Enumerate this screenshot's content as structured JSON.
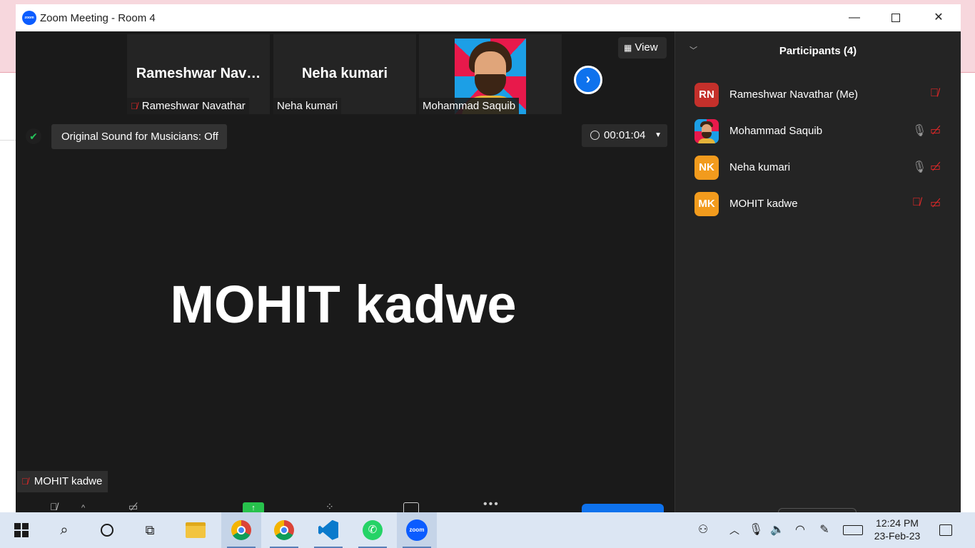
{
  "window": {
    "title": "Zoom Meeting - Room 4",
    "app_icon_text": "zoom",
    "controls": {
      "minimize": "—",
      "close": "✕"
    }
  },
  "thumbnails": [
    {
      "display": "Rameshwar  Nav…",
      "label": "Rameshwar Navathar",
      "muted": true
    },
    {
      "display": "Neha kumari",
      "label": "Neha kumari",
      "muted": false
    },
    {
      "display": "",
      "label": "Mohammad Saquib",
      "muted": false,
      "has_avatar": true
    }
  ],
  "controls_overlay": {
    "next_page": "›",
    "view_label": "View",
    "view_icon": "grid-icon",
    "original_sound": "Original Sound for Musicians: Off",
    "timer": "00:01:04"
  },
  "active_speaker": {
    "name": "MOHIT kadwe",
    "label": "MOHIT kadwe",
    "muted": true
  },
  "participants_panel": {
    "title": "Participants (4)",
    "participants": [
      {
        "initials": "RN",
        "name": "Rameshwar Navathar (Me)",
        "color": "#c4302b",
        "mic": "muted",
        "cam": "none"
      },
      {
        "initials": "",
        "name": "Mohammad Saquib",
        "color": "#e8194b",
        "mic": "on",
        "cam": "off",
        "has_avatar": true
      },
      {
        "initials": "NK",
        "name": "Neha kumari",
        "color": "#f29b1d",
        "mic": "on",
        "cam": "off"
      },
      {
        "initials": "MK",
        "name": "MOHIT kadwe",
        "color": "#f29b1d",
        "mic": "muted",
        "cam": "off"
      }
    ]
  },
  "taskbar": {
    "zoom_label": "zoom",
    "time": "12:24 PM",
    "date": "23-Feb-23",
    "apps": [
      "file-explorer",
      "chrome",
      "chrome",
      "vscode",
      "whatsapp",
      "zoom"
    ]
  },
  "colors": {
    "zoom_blue": "#0e72ed",
    "muted_red": "#e02828",
    "panel_bg": "#242424",
    "video_bg": "#1a1a1a"
  }
}
